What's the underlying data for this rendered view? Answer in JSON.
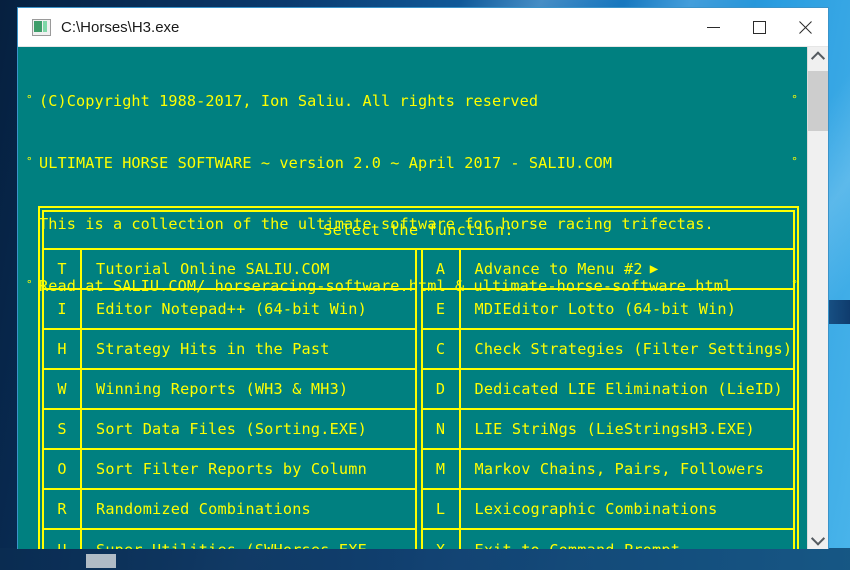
{
  "window": {
    "title": "C:\\Horses\\H3.exe",
    "icon": "console-app-icon",
    "minimize_label": "Minimize",
    "maximize_label": "Maximize",
    "close_label": "Close"
  },
  "colors": {
    "console_background": "#008080",
    "console_text": "#FFFF00",
    "titlebar_background": "#FFFFFF",
    "desktop": "#0B3A6E",
    "scrollbar_track": "#F0F0F0",
    "scrollbar_thumb": "#CDCDCD"
  },
  "header": {
    "lines": [
      {
        "bullet_left": "°",
        "text": "(C)Copyright 1988-2017, Ion Saliu. All rights reserved",
        "bullet_right": "°"
      },
      {
        "bullet_left": "°",
        "text": "ULTIMATE HORSE SOFTWARE ~ version 2.0 ~ April 2017 - SALIU.COM",
        "bullet_right": "°"
      },
      {
        "bullet_left": "",
        "text": "This is a collection of the ultimate software for horse racing trifectas.",
        "bullet_right": ""
      },
      {
        "bullet_left": "°",
        "text": "Read at SALIU.COM/ horseracing-software.html & ultimate-horse-software.html",
        "bullet_right": "°"
      }
    ]
  },
  "menu": {
    "title": "Select the function:",
    "left_column": [
      {
        "key": "T",
        "label": "Tutorial Online SALIU.COM",
        "arrow": ""
      },
      {
        "key": "I",
        "label": "Editor Notepad++ (64-bit Win)",
        "arrow": ""
      },
      {
        "key": "H",
        "label": "Strategy Hits in the Past",
        "arrow": ""
      },
      {
        "key": "W",
        "label": "Winning Reports (WH3 & MH3)",
        "arrow": ""
      },
      {
        "key": "S",
        "label": "Sort Data Files (Sorting.EXE)",
        "arrow": ""
      },
      {
        "key": "O",
        "label": "Sort Filter Reports by Column",
        "arrow": ""
      },
      {
        "key": "R",
        "label": "Randomized Combinations",
        "arrow": ""
      },
      {
        "key": "U",
        "label": "Super Utilities (SWHorses.EXE",
        "arrow": ""
      }
    ],
    "right_column": [
      {
        "key": "A",
        "label": "Advance to Menu #2",
        "arrow": "▶"
      },
      {
        "key": "E",
        "label": "MDIEditor Lotto (64-bit Win)",
        "arrow": ""
      },
      {
        "key": "C",
        "label": "Check Strategies (Filter Settings)",
        "arrow": ""
      },
      {
        "key": "D",
        "label": "Dedicated LIE Elimination (LieID)",
        "arrow": ""
      },
      {
        "key": "N",
        "label": "LIE StriNgs (LieStringsH3.EXE)",
        "arrow": ""
      },
      {
        "key": "M",
        "label": "Markov Chains, Pairs, Followers",
        "arrow": ""
      },
      {
        "key": "L",
        "label": "Lexicographic Combinations",
        "arrow": ""
      },
      {
        "key": "X",
        "label": "Exit to Command Prompt",
        "arrow": ""
      }
    ]
  },
  "scrollbar": {
    "up_arrow": "scroll-up-icon",
    "down_arrow": "scroll-down-icon",
    "thumb": "scrollbar-thumb"
  }
}
